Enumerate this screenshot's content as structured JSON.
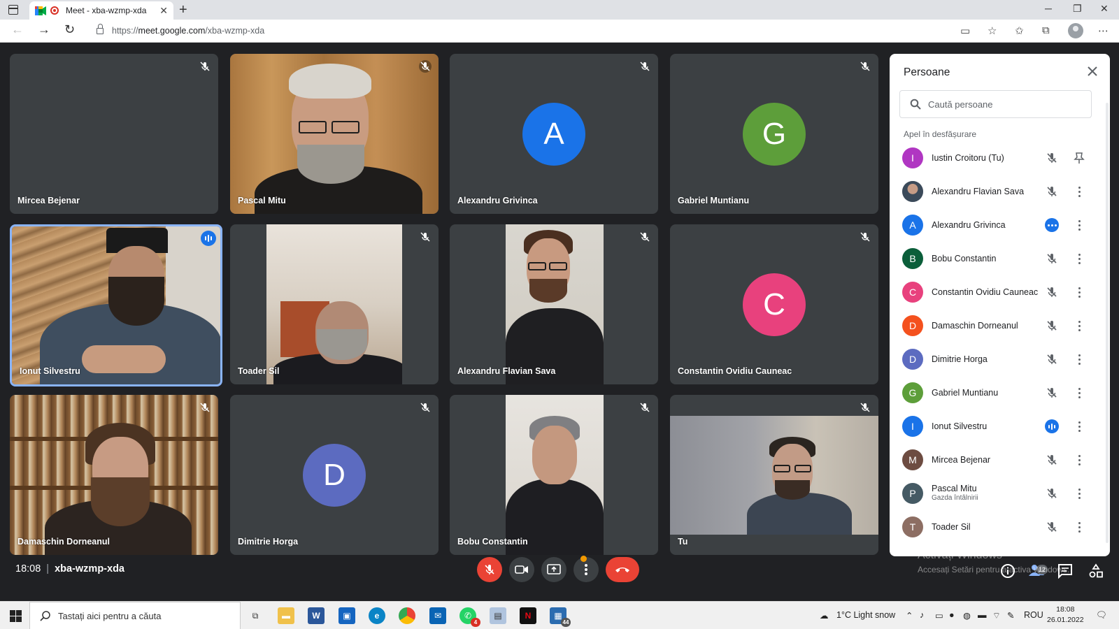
{
  "browser": {
    "tab_title": "Meet - xba-wzmp-xda",
    "url_prefix": "https://",
    "url_domain": "meet.google.com",
    "url_path": "/xba-wzmp-xda"
  },
  "tiles": [
    {
      "name": "Mircea Bejenar"
    },
    {
      "name": "Pascal Mitu"
    },
    {
      "name": "Alexandru Grivinca",
      "initial": "A",
      "color": "#1a73e8"
    },
    {
      "name": "Gabriel Muntianu",
      "initial": "G",
      "color": "#5d9e3a"
    },
    {
      "name": "Ionut Silvestru"
    },
    {
      "name": "Toader Sil"
    },
    {
      "name": "Alexandru Flavian Sava"
    },
    {
      "name": "Constantin Ovidiu Cauneac",
      "initial": "C",
      "color": "#e8417d"
    },
    {
      "name": "Damaschin Dorneanul"
    },
    {
      "name": "Dimitrie Horga",
      "initial": "D",
      "color": "#5c6bc0"
    },
    {
      "name": "Bobu Constantin"
    },
    {
      "name": "Tu"
    }
  ],
  "meeting": {
    "time": "18:08",
    "code": "xba-wzmp-xda",
    "participant_count": "12"
  },
  "panel": {
    "title": "Persoane",
    "search_placeholder": "Caută persoane",
    "section_label": "Apel în desfășurare",
    "people": [
      {
        "name": "Iustin Croitoru (Tu)",
        "initial": "I",
        "color": "#b036c2",
        "status": "muted-pin"
      },
      {
        "name": "Alexandru Flavian Sava",
        "initial": "",
        "color": "#8a8f94",
        "status": "muted"
      },
      {
        "name": "Alexandru Grivinca",
        "initial": "A",
        "color": "#1a73e8",
        "status": "dots"
      },
      {
        "name": "Bobu Constantin",
        "initial": "B",
        "color": "#0b5e3a",
        "status": "muted"
      },
      {
        "name": "Constantin Ovidiu Cauneac",
        "initial": "C",
        "color": "#e8417d",
        "status": "muted"
      },
      {
        "name": "Damaschin Dorneanul",
        "initial": "D",
        "color": "#f4511e",
        "status": "muted"
      },
      {
        "name": "Dimitrie Horga",
        "initial": "D",
        "color": "#5c6bc0",
        "status": "muted"
      },
      {
        "name": "Gabriel Muntianu",
        "initial": "G",
        "color": "#5d9e3a",
        "status": "muted"
      },
      {
        "name": "Ionut Silvestru",
        "initial": "I",
        "color": "#1a73e8",
        "status": "speaking"
      },
      {
        "name": "Mircea Bejenar",
        "initial": "M",
        "color": "#6d4c41",
        "status": "muted"
      },
      {
        "name": "Pascal Mitu",
        "initial": "P",
        "color": "#455a64",
        "status": "muted",
        "sub": "Gazda întâlnirii"
      },
      {
        "name": "Toader Sil",
        "initial": "T",
        "color": "#8d6e63",
        "status": "muted"
      }
    ]
  },
  "watermark": {
    "line1": "Activați Windows",
    "line2": "Accesați Setări pentru a activa Windows."
  },
  "taskbar": {
    "search_placeholder": "Tastați aici pentru a căuta",
    "weather": "1°C  Light snow",
    "language": "ROU",
    "time": "18:08",
    "date": "26.01.2022",
    "whatsapp_badge": "4",
    "app_badge": "44"
  }
}
